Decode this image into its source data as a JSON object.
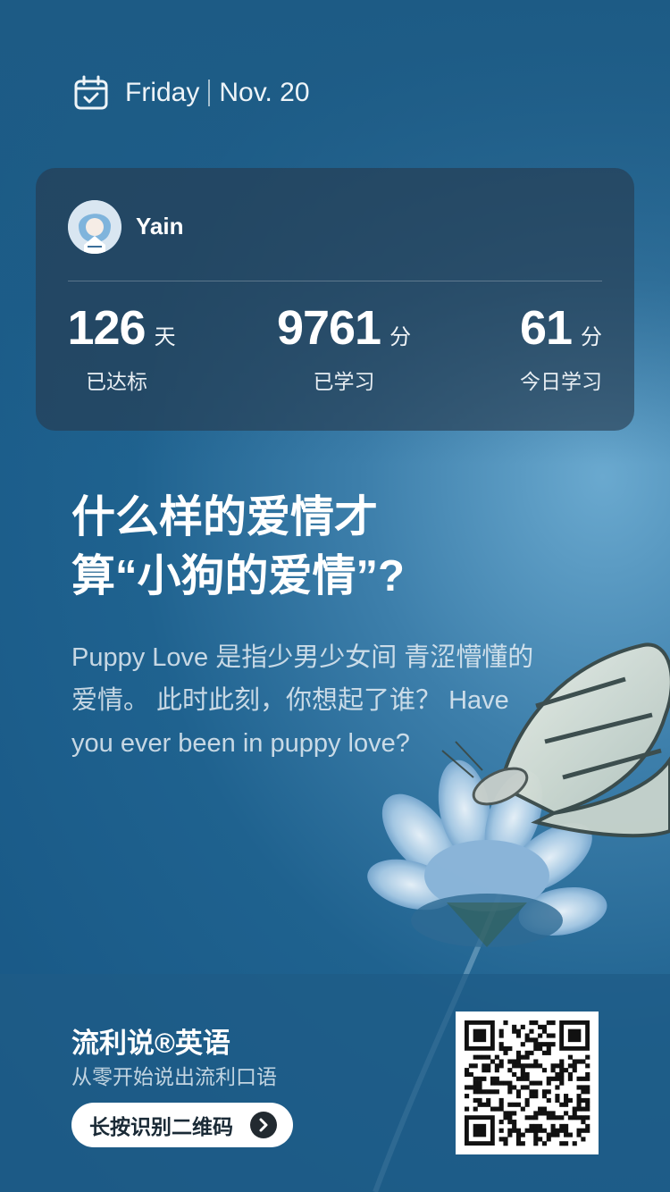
{
  "header": {
    "weekday": "Friday",
    "date": "Nov. 20",
    "icon": "calendar-check-icon"
  },
  "profile": {
    "username": "Yain",
    "avatar": "avatar"
  },
  "stats": [
    {
      "value": "126",
      "unit": "天",
      "label": "已达标"
    },
    {
      "value": "9761",
      "unit": "分",
      "label": "已学习"
    },
    {
      "value": "61",
      "unit": "分",
      "label": "今日学习"
    }
  ],
  "article": {
    "title_line1": "什么样的爱情才",
    "title_line2": "算“小狗的爱情”?",
    "body": "Puppy Love 是指少男少女间 青涩懵懂的爱情。 此时此刻，你想起了谁？ Have you ever been in puppy love?"
  },
  "footer": {
    "brand": "流利说®英语",
    "slogan": "从零开始说出流利口语",
    "cta_label": "长按识别二维码",
    "cta_icon": "chevron-right-icon",
    "qr_icon": "qr-code"
  },
  "colors": {
    "background": "#1f628f",
    "card": "#263a4e",
    "accent": "#ffffff"
  }
}
